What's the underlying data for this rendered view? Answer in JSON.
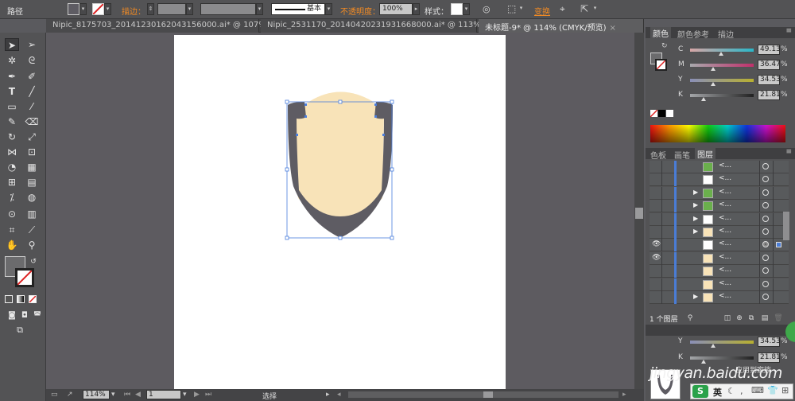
{
  "control_bar": {
    "mode_label": "路径",
    "stroke_label": "描边：",
    "stroke_style_label": "基本",
    "opacity_label": "不透明度：",
    "opacity_value": "100%",
    "style_label": "样式：",
    "transform_label": "变换"
  },
  "tabs": [
    {
      "label": "Nipic_8175703_20141230162043156000.ai* @ 107% ...",
      "close": "×"
    },
    {
      "label": "Nipic_2531170_20140420231931668000.ai* @ 113% ...",
      "close": "×"
    },
    {
      "label": "未标题-9* @ 114% (CMYK/预览)",
      "close": "×"
    }
  ],
  "status_bar": {
    "zoom": "114%",
    "page": "1",
    "status_text": "选择"
  },
  "color_panel": {
    "tabs": [
      "颜色",
      "颜色参考",
      "描边"
    ],
    "sliders": [
      {
        "key": "C",
        "value": "49.13",
        "unit": "%",
        "level": 0.49,
        "color": "#2ab7c8"
      },
      {
        "key": "M",
        "value": "36.47",
        "unit": "%",
        "level": 0.36,
        "color": "#c0306b"
      },
      {
        "key": "Y",
        "value": "34.53",
        "unit": "%",
        "level": 0.35,
        "color": "#b8b030"
      },
      {
        "key": "K",
        "value": "21.81",
        "unit": "%",
        "level": 0.22,
        "color": "#222222"
      }
    ]
  },
  "layers_panel": {
    "tabs": [
      "色板",
      "画笔",
      "图层"
    ],
    "footer_label": "1 个图层",
    "rows": [
      {
        "thumb": "#6ab04c",
        "expand": false,
        "eye": false,
        "name": "<...",
        "target": false
      },
      {
        "thumb": "#ffffff",
        "expand": false,
        "eye": false,
        "name": "<...",
        "target": false
      },
      {
        "thumb": "#6ab04c",
        "expand": true,
        "eye": false,
        "name": "<...",
        "target": false
      },
      {
        "thumb": "#6ab04c",
        "expand": true,
        "eye": false,
        "name": "<...",
        "target": false
      },
      {
        "thumb": "#ffffff",
        "expand": true,
        "eye": false,
        "name": "<...",
        "target": false
      },
      {
        "thumb": "#f8e3b8",
        "expand": true,
        "eye": false,
        "name": "<...",
        "target": false
      },
      {
        "thumb": "#ffffff",
        "expand": false,
        "eye": true,
        "name": "<...",
        "target": true
      },
      {
        "thumb": "#f8e3b8",
        "expand": false,
        "eye": true,
        "name": "<...",
        "target": false
      },
      {
        "thumb": "#f8e3b8",
        "expand": false,
        "eye": false,
        "name": "<...",
        "target": false
      },
      {
        "thumb": "#f8e3b8",
        "expand": false,
        "eye": false,
        "name": "<...",
        "target": false
      },
      {
        "thumb": "#f8e3b8",
        "expand": true,
        "eye": false,
        "name": "<...",
        "target": false
      }
    ]
  },
  "lower_panel": {
    "sliders": [
      {
        "key": "Y",
        "value": "34.53",
        "unit": "%",
        "level": 0.35,
        "color": "#b8b030"
      },
      {
        "key": "K",
        "value": "21.81",
        "unit": "%",
        "level": 0.22,
        "color": "#222222"
      }
    ],
    "overlay_text": "应用到家族"
  },
  "watermark": "jingyan.baidu.com",
  "ime": {
    "label": "英"
  },
  "colors": {
    "skin": "#f8e3b8",
    "hair": "#5e5c63",
    "selection": "#4a7ddc"
  }
}
